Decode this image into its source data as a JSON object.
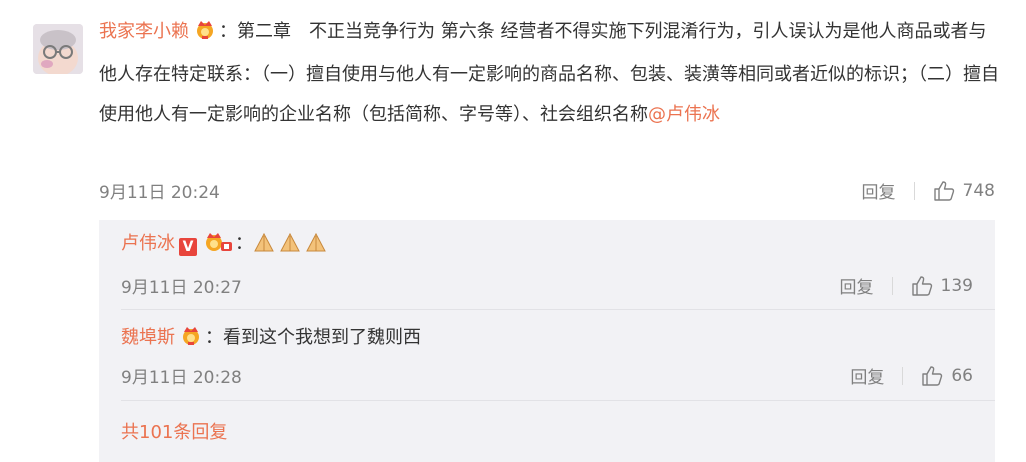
{
  "comment": {
    "username": "我家李小赖",
    "colon": "：",
    "text": "第二章　不正当竞争行为 第六条 经营者不得实施下列混淆行为，引人误认为是他人商品或者与他人存在特定联系：（一）擅自使用与他人有一定影响的商品名称、包装、装潢等相同或者近似的标识；（二）擅自使用他人有一定影响的企业名称（包括简称、字号等）、社会组织名称",
    "mention": "@卢伟冰",
    "time": "9月11日 20:24",
    "reply_label": "回复",
    "likes": "748"
  },
  "replies": [
    {
      "username": "卢伟冰",
      "verified_badge": "V",
      "colon": "：",
      "text": "",
      "emoji": "folded-hands-emoji x3",
      "time": "9月11日 20:27",
      "reply_label": "回复",
      "likes": "139"
    },
    {
      "username": "魏埠斯",
      "colon": "：",
      "text": "看到这个我想到了魏则西",
      "time": "9月11日 20:28",
      "reply_label": "回复",
      "likes": "66"
    }
  ],
  "more_replies": "共101条回复",
  "colors": {
    "accent": "#eb7350",
    "meta": "#808080",
    "reply_bg": "#f2f2f5",
    "verified": "#e8453c"
  }
}
